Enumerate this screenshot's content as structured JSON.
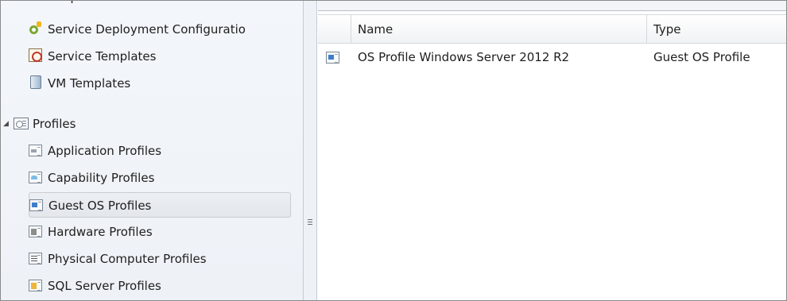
{
  "nav": {
    "partial_top_label": "Templates",
    "template_items": [
      {
        "label": "Service Deployment Configuratio",
        "icon": "service-deployment-icon"
      },
      {
        "label": "Service Templates",
        "icon": "service-template-icon"
      },
      {
        "label": "VM Templates",
        "icon": "vm-template-icon"
      }
    ],
    "profiles_group": {
      "label": "Profiles",
      "icon": "profiles-icon",
      "expanded": true
    },
    "profile_items": [
      {
        "label": "Application Profiles",
        "icon": "application-profile-icon"
      },
      {
        "label": "Capability Profiles",
        "icon": "capability-profile-icon"
      },
      {
        "label": "Guest OS Profiles",
        "icon": "guest-os-profile-icon",
        "selected": true
      },
      {
        "label": "Hardware Profiles",
        "icon": "hardware-profile-icon"
      },
      {
        "label": "Physical Computer Profiles",
        "icon": "physical-computer-profile-icon"
      },
      {
        "label": "SQL Server Profiles",
        "icon": "sql-server-profile-icon"
      }
    ]
  },
  "list": {
    "columns": [
      "Name",
      "Type"
    ],
    "rows": [
      {
        "name": "OS Profile Windows Server 2012 R2",
        "type": "Guest OS Profile",
        "icon": "guest-os-profile-icon"
      }
    ]
  },
  "colors": {
    "nav_background": "#eef2f7",
    "selected_item": "#e3e7ec",
    "accent_blue": "#3e7ec9"
  }
}
